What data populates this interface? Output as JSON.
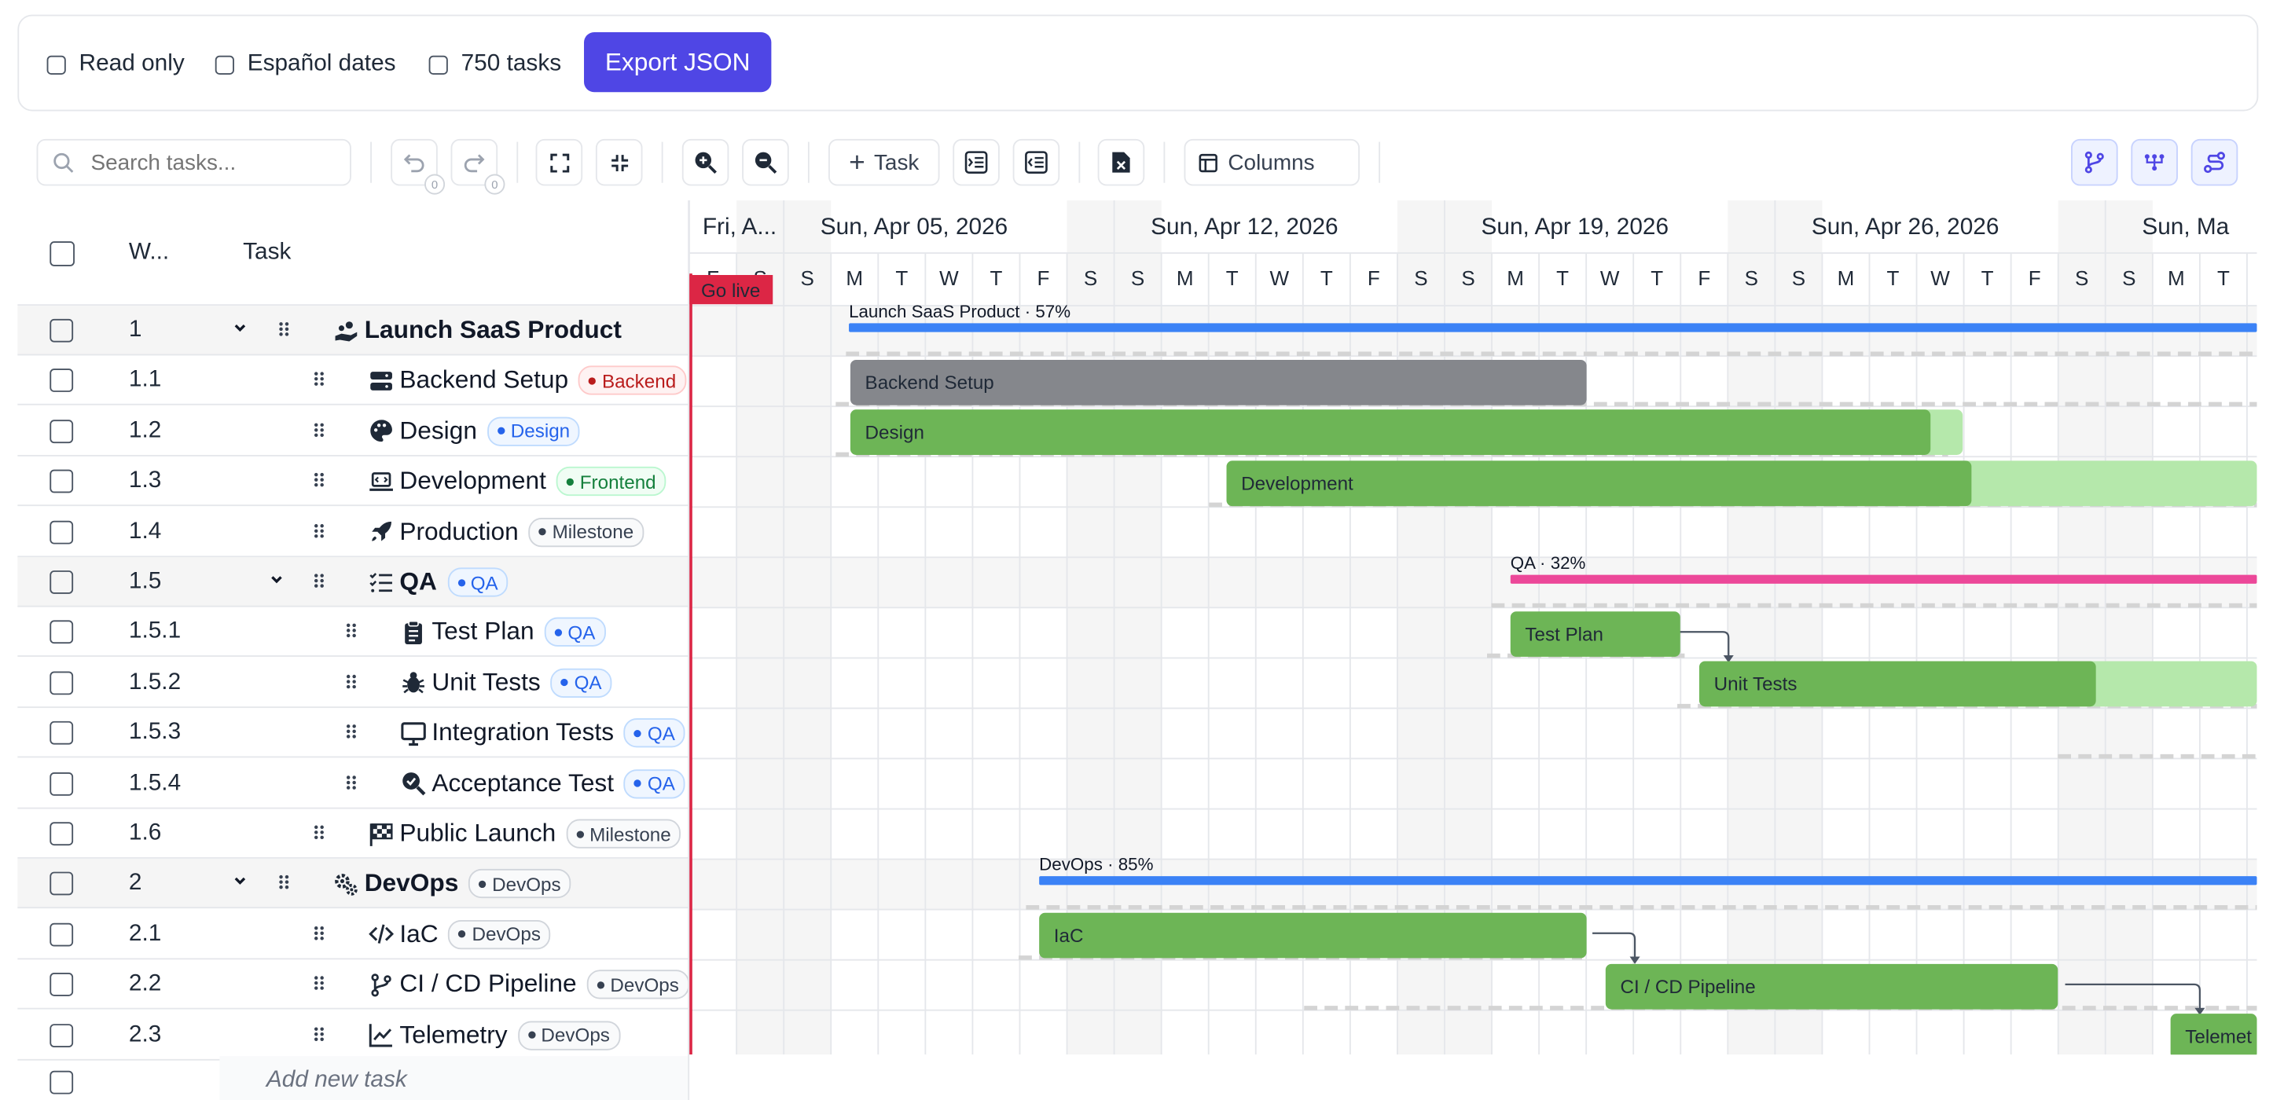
{
  "toolbar_top": {
    "read_only": "Read only",
    "spanish_dates": "Español dates",
    "tasks_750": "750 tasks",
    "export_json": "Export JSON"
  },
  "toolbar": {
    "search_placeholder": "Search tasks...",
    "add_task": "Task",
    "columns": "Columns",
    "undo_count": "0",
    "redo_count": "0"
  },
  "grid": {
    "headers": {
      "wbs": "W...",
      "task": "Task"
    },
    "add_new_task": "Add new task"
  },
  "rows": [
    {
      "wbs": "1",
      "name": "Launch SaaS Product",
      "icon": "hand-coins-icon",
      "tag": "",
      "level": 0,
      "summary": true,
      "toggle": "expanded"
    },
    {
      "wbs": "1.1",
      "name": "Backend Setup",
      "icon": "server-icon",
      "tag": "Backend",
      "level": 1
    },
    {
      "wbs": "1.2",
      "name": "Design",
      "icon": "palette-icon",
      "tag": "Design",
      "level": 1
    },
    {
      "wbs": "1.3",
      "name": "Development",
      "icon": "laptop-code-icon",
      "tag": "Frontend",
      "level": 1
    },
    {
      "wbs": "1.4",
      "name": "Production",
      "icon": "rocket-icon",
      "tag": "Milestone",
      "level": 1
    },
    {
      "wbs": "1.5",
      "name": "QA",
      "icon": "checklist-icon",
      "tag": "QA",
      "level": 1,
      "summary": true,
      "toggle": "expanded"
    },
    {
      "wbs": "1.5.1",
      "name": "Test Plan",
      "icon": "clipboard-icon",
      "tag": "QA",
      "level": 2
    },
    {
      "wbs": "1.5.2",
      "name": "Unit Tests",
      "icon": "bug-icon",
      "tag": "QA",
      "level": 2
    },
    {
      "wbs": "1.5.3",
      "name": "Integration Tests",
      "icon": "monitor-icon",
      "tag": "QA",
      "level": 2
    },
    {
      "wbs": "1.5.4",
      "name": "Acceptance Test",
      "icon": "magnifier-check-icon",
      "tag": "QA",
      "level": 2
    },
    {
      "wbs": "1.6",
      "name": "Public Launch",
      "icon": "checkered-flag-icon",
      "tag": "Milestone",
      "level": 1
    },
    {
      "wbs": "2",
      "name": "DevOps",
      "icon": "gears-icon",
      "tag": "DevOps",
      "level": 0,
      "summary": true,
      "toggle": "expanded"
    },
    {
      "wbs": "2.1",
      "name": "IaC",
      "icon": "code-icon",
      "tag": "DevOps",
      "level": 1
    },
    {
      "wbs": "2.2",
      "name": "CI / CD Pipeline",
      "icon": "git-branch-icon",
      "tag": "DevOps",
      "level": 1
    },
    {
      "wbs": "2.3",
      "name": "Telemetry",
      "icon": "line-chart-icon",
      "tag": "DevOps",
      "level": 1
    }
  ],
  "timeline": {
    "weeks": [
      "Fri, A...",
      "Sun, Apr 05, 2026",
      "Sun, Apr 12, 2026",
      "Sun, Apr 19, 2026",
      "Sun, Apr 26, 2026",
      "Sun, Ma"
    ],
    "days": [
      "F",
      "S",
      "S",
      "M",
      "T",
      "W",
      "T",
      "F",
      "S",
      "S",
      "M",
      "T",
      "W",
      "T",
      "F",
      "S",
      "S",
      "M",
      "T",
      "W",
      "T",
      "F",
      "S",
      "S",
      "M",
      "T",
      "W",
      "T",
      "F",
      "S",
      "S",
      "M",
      "T"
    ],
    "go_live": "Go live"
  },
  "bars": {
    "launch_summary": "Launch SaaS Product · 57%",
    "backend": "Backend Setup",
    "design": "Design",
    "development": "Development",
    "qa_summary": "QA · 32%",
    "test_plan": "Test Plan",
    "unit_tests": "Unit Tests",
    "devops_summary": "DevOps · 85%",
    "iac": "IaC",
    "cicd": "CI / CD Pipeline",
    "telemetry": "Telemet"
  },
  "tag_colors": {
    "Backend": "#b91c1c",
    "Design": "#2563eb",
    "Frontend": "#15803d",
    "Milestone": "#4b5563",
    "QA": "#2563eb",
    "DevOps": "#4b5563"
  },
  "colors": {
    "accent": "#4f46e5",
    "summary_blue": "#3b82f6",
    "summary_pink": "#ec4899",
    "bar_green": "#6db556",
    "bar_gray": "#85878c",
    "go_live_red": "#dc2645"
  }
}
